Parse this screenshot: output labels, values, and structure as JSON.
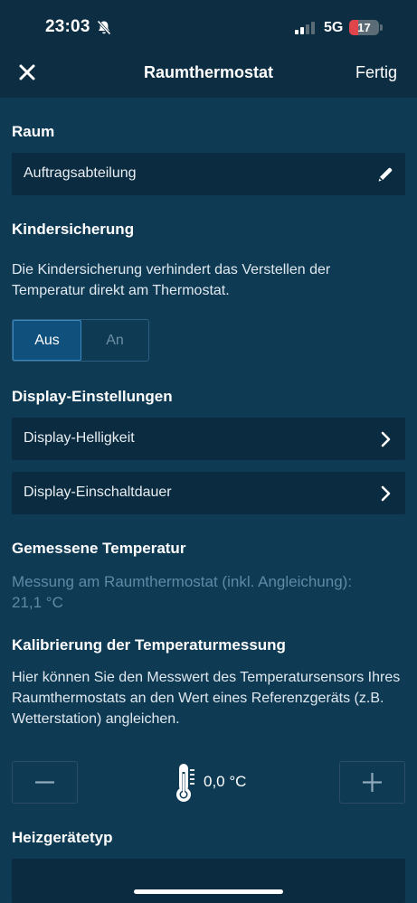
{
  "status_bar": {
    "time": "23:03",
    "network": "5G",
    "battery": "17"
  },
  "nav": {
    "title": "Raumthermostat",
    "done_label": "Fertig"
  },
  "room": {
    "title": "Raum",
    "value": "Auftragsabteilung"
  },
  "child_lock": {
    "title": "Kindersicherung",
    "description": "Die Kindersicherung verhindert das Verstellen der Temperatur direkt am Thermostat.",
    "options": {
      "off": "Aus",
      "on": "An"
    },
    "selected": "Aus"
  },
  "display_settings": {
    "title": "Display-Einstellungen",
    "items": [
      {
        "label": "Display-Helligkeit"
      },
      {
        "label": "Display-Einschaltdauer"
      }
    ]
  },
  "measured_temperature": {
    "title": "Gemessene Temperatur",
    "description": "Messung am Raumthermostat (inkl. Angleichung):",
    "value": "21,1 °C"
  },
  "calibration": {
    "title": "Kalibrierung der Temperaturmessung",
    "description": "Hier können Sie den Messwert des Temperatursensors Ihres Raumthermostats an den Wert eines Referenzgeräts (z.B. Wetterstation) angleichen.",
    "value": "0,0 °C"
  },
  "heater_type": {
    "title": "Heizgerätetyp"
  },
  "colors": {
    "background": "#0f3a54",
    "header": "#0d2d42",
    "field": "#0b2b40",
    "accent": "#10507c",
    "muted": "#5f8aa6"
  }
}
